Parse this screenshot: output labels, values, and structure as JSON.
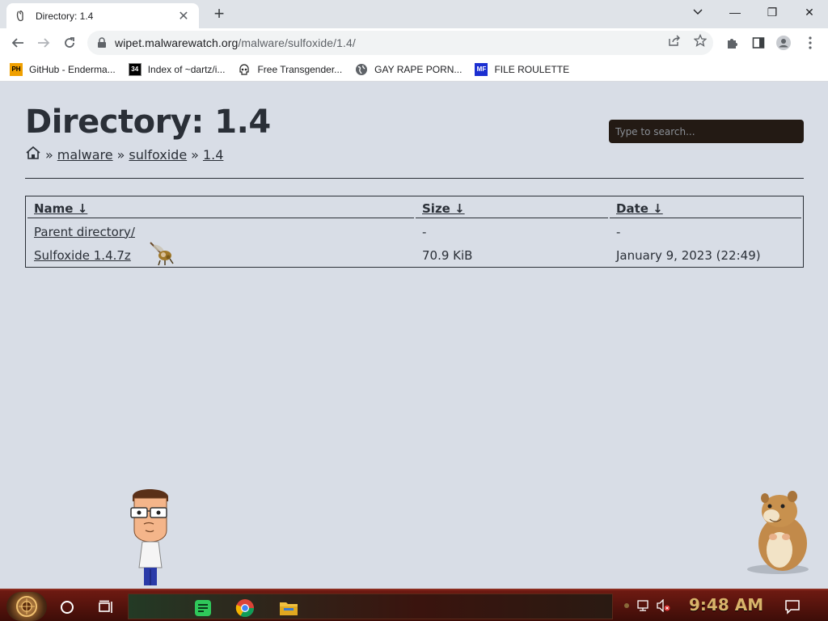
{
  "browser": {
    "tab": {
      "title": "Directory: 1.4",
      "close": "✕"
    },
    "new_tab": "+",
    "window": {
      "minimize": "—",
      "maximize": "❐",
      "close": "✕"
    },
    "url": {
      "host": "wipet.malwarewatch.org",
      "path": "/malware/sulfoxide/1.4/"
    },
    "bookmarks": [
      {
        "label": "GitHub - Enderma...",
        "icon": "PH"
      },
      {
        "label": "Index of ~dartz/i...",
        "icon": "34"
      },
      {
        "label": "Free Transgender...",
        "icon": "skull-icon"
      },
      {
        "label": "GAY RAPE PORN...",
        "icon": "globe-icon"
      },
      {
        "label": "FILE ROULETTE",
        "icon": "MF"
      }
    ]
  },
  "page": {
    "title": "Directory: 1.4",
    "search_placeholder": "Type to search...",
    "breadcrumb": {
      "home_icon": "house-icon",
      "sep": "»",
      "items": [
        "malware",
        "sulfoxide",
        "1.4"
      ]
    },
    "table": {
      "headers": [
        "Name ↓",
        "Size ↓",
        "Date ↓"
      ],
      "rows": [
        {
          "name": "Parent directory/",
          "size": "-",
          "date": "-"
        },
        {
          "name": "Sulfoxide 1.4.7z",
          "size": "70.9 KiB",
          "date": "January 9, 2023 (22:49)"
        }
      ]
    }
  },
  "taskbar": {
    "clock": "9:48 AM",
    "accent": "#6e1a12"
  }
}
